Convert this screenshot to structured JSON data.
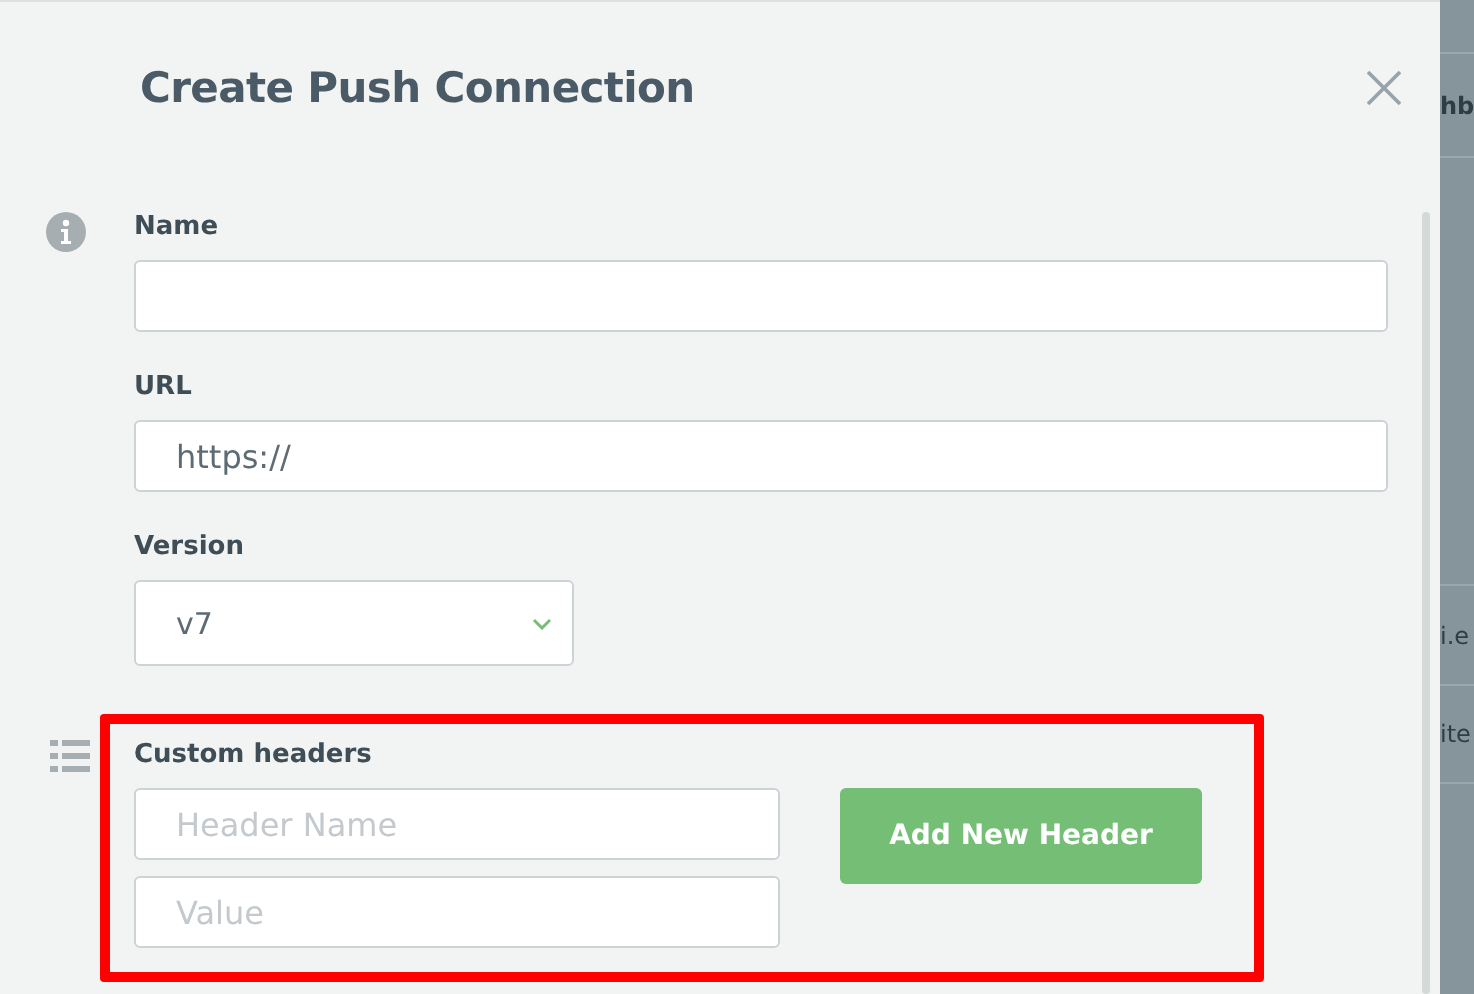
{
  "dialog": {
    "title": "Create Push Connection"
  },
  "fields": [
    {
      "kind": "text",
      "label": "Name"
    },
    {
      "kind": "text",
      "label": "URL",
      "value": "https://"
    },
    {
      "kind": "select",
      "label": "Version",
      "value": "v7"
    }
  ],
  "custom_headers": {
    "label": "Custom headers",
    "name_placeholder": "Header Name",
    "value_placeholder": "Value",
    "button": "Add New Header",
    "highlighted": true
  },
  "background": {
    "texts": [
      "hb",
      "i.e",
      "ite"
    ]
  }
}
